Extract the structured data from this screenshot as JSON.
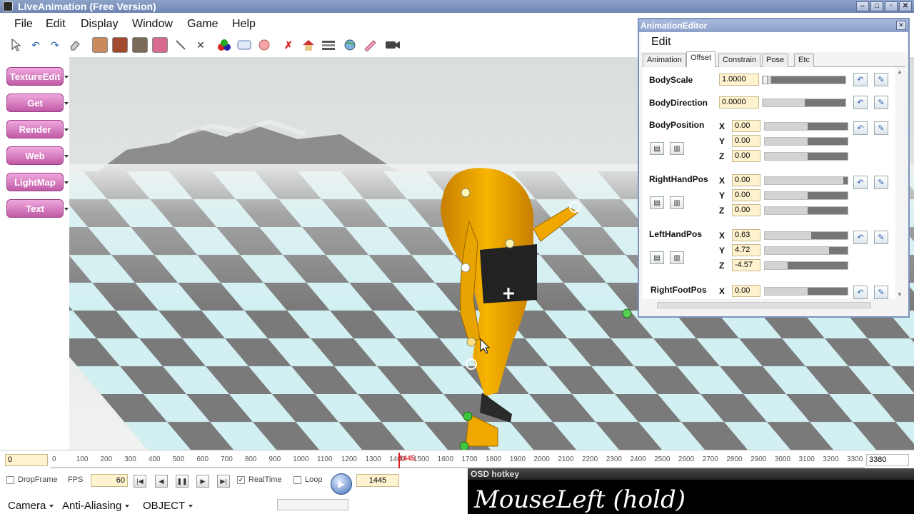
{
  "window": {
    "title": "LiveAnimation (Free Version)"
  },
  "menu": [
    "File",
    "Edit",
    "Display",
    "Window",
    "Game",
    "Help"
  ],
  "toolbar": {
    "icons": [
      "pointer-tool",
      "undo",
      "redo",
      "eraser",
      "character-1",
      "character-2",
      "character-3",
      "character-4",
      "bone-tool",
      "delete",
      "color-triangle",
      "window-tool",
      "morph-tool",
      "red-x-tool",
      "house-tool",
      "stripes-tool",
      "globe-tool",
      "pencil-tool",
      "video-camera"
    ]
  },
  "left_panel": [
    {
      "label": "TextureEdit"
    },
    {
      "label": "Get"
    },
    {
      "label": "Render"
    },
    {
      "label": "Web"
    },
    {
      "label": "LightMap"
    },
    {
      "label": "Text"
    }
  ],
  "timeline": {
    "start": "0",
    "end": "3380",
    "marker": "1445",
    "ticks": [
      "0",
      "100",
      "200",
      "300",
      "400",
      "500",
      "600",
      "700",
      "800",
      "900",
      "1000",
      "1100",
      "1200",
      "1300",
      "1400",
      "1500",
      "1600",
      "1700",
      "1800",
      "1900",
      "2000",
      "2100",
      "2200",
      "2300",
      "2400",
      "2500",
      "2600",
      "2700",
      "2800",
      "2900",
      "3000",
      "3100",
      "3200",
      "3300"
    ]
  },
  "playback": {
    "dropframe_label": "DropFrame",
    "fps_label": "FPS",
    "fps_value": "60",
    "realtime_label": "RealTime",
    "loop_label": "Loop",
    "current_frame": "1445"
  },
  "statusbar": {
    "camera": "Camera",
    "antialias": "Anti-Aliasing",
    "object": "OBJECT"
  },
  "osd": {
    "title": "OSD hotkey",
    "text": "MouseLeft (hold)"
  },
  "editor": {
    "title": "AnimationEditor",
    "heading": "Edit",
    "tabs": [
      "Animation",
      "Offset",
      "Constrain",
      "Pose",
      "Etc"
    ],
    "active_tab": "Offset",
    "props": {
      "body_scale": {
        "label": "BodyScale",
        "value": "1.0000",
        "level": 0.0
      },
      "body_direction": {
        "label": "BodyDirection",
        "value": "0.0000",
        "level": 0.5
      },
      "body_position": {
        "label": "BodyPosition",
        "x": "0.00",
        "y": "0.00",
        "z": "0.00"
      },
      "right_hand_pos": {
        "label": "RightHandPos",
        "x": "0.00",
        "y": "0.00",
        "z": "0.00"
      },
      "left_hand_pos": {
        "label": "LeftHandPos",
        "x": "0.63",
        "y": "4.72",
        "z": "-4.57"
      },
      "right_foot_pos": {
        "label": "RightFootPos",
        "x": "0.00"
      }
    }
  },
  "colors": {
    "title_bar": "#7a90bd",
    "accent_pink": "#d27cc0",
    "character_orange": "#f0a800",
    "floor_light": "#cfeff0",
    "floor_dark": "#6f6f6f"
  }
}
